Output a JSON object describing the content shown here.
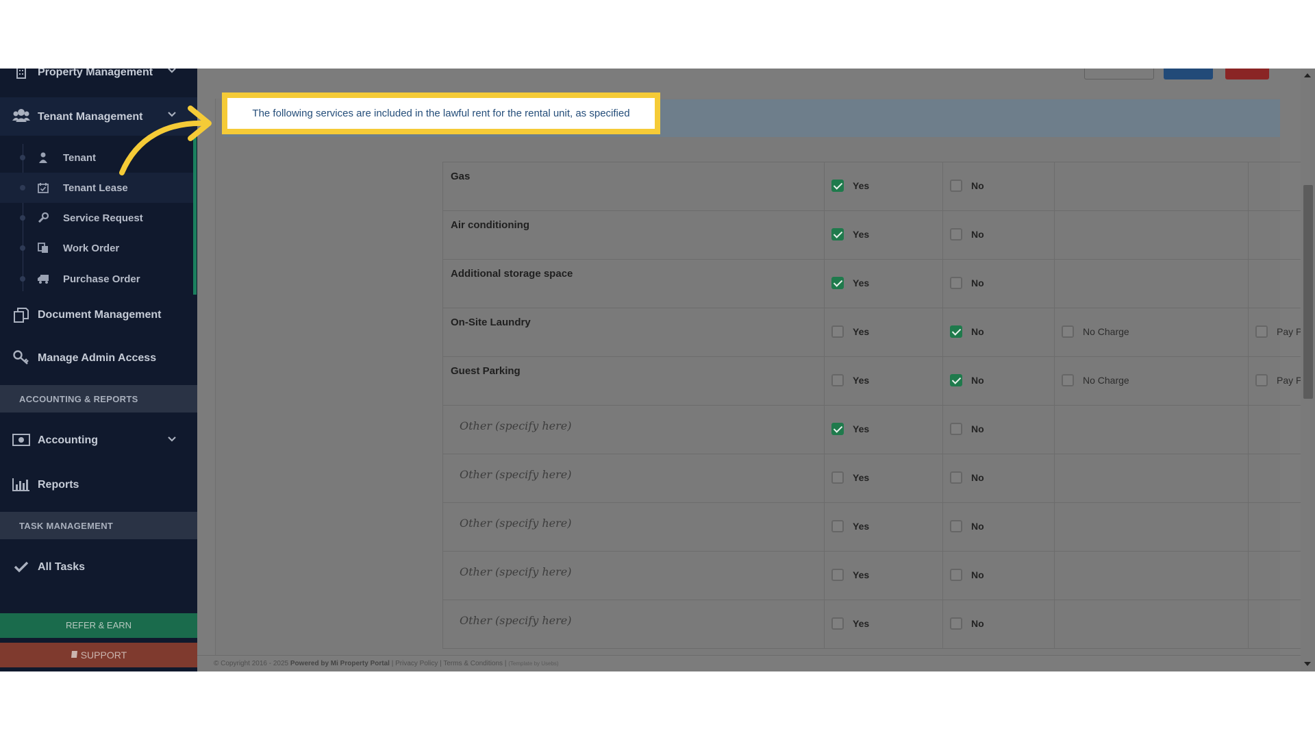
{
  "sidebar": {
    "items": [
      {
        "label": "Property Management",
        "icon": "building-icon",
        "has_chevron": true
      },
      {
        "label": "Tenant Management",
        "icon": "users-icon",
        "has_chevron": true
      },
      {
        "label": "Document Management",
        "icon": "documents-icon"
      },
      {
        "label": "Manage Admin Access",
        "icon": "key-icon"
      },
      {
        "label": "Accounting",
        "icon": "money-icon",
        "has_chevron": true
      },
      {
        "label": "Reports",
        "icon": "bar-chart-icon"
      },
      {
        "label": "All Tasks",
        "icon": "check-icon"
      }
    ],
    "sub_items": [
      {
        "label": "Tenant",
        "icon": "user-icon"
      },
      {
        "label": "Tenant Lease",
        "icon": "calendar-check-icon"
      },
      {
        "label": "Service Request",
        "icon": "wrench-icon"
      },
      {
        "label": "Work Order",
        "icon": "copy-icon"
      },
      {
        "label": "Purchase Order",
        "icon": "truck-icon"
      }
    ],
    "sections": {
      "accounting": "ACCOUNTING & REPORTS",
      "tasks": "TASK MANAGEMENT"
    },
    "refer_label": "REFER & EARN",
    "support_label": "SUPPORT"
  },
  "highlight_text": "The following services are included in the lawful rent for the rental unit, as specified",
  "services": [
    {
      "name": "Gas",
      "yes": true,
      "no": false
    },
    {
      "name": "Air conditioning",
      "yes": true,
      "no": false
    },
    {
      "name": "Additional storage space",
      "yes": true,
      "no": false
    },
    {
      "name": "On-Site Laundry",
      "yes": false,
      "no": true,
      "extra": true
    },
    {
      "name": "Guest Parking",
      "yes": false,
      "no": true,
      "extra": true
    },
    {
      "name": "Other (specify here)",
      "placeholder": true,
      "yes": true,
      "no": false
    },
    {
      "name": "Other (specify here)",
      "placeholder": true,
      "yes": false,
      "no": false
    },
    {
      "name": "Other (specify here)",
      "placeholder": true,
      "yes": false,
      "no": false
    },
    {
      "name": "Other (specify here)",
      "placeholder": true,
      "yes": false,
      "no": false
    },
    {
      "name": "Other (specify here)",
      "placeholder": true,
      "yes": false,
      "no": false
    }
  ],
  "option_labels": {
    "yes": "Yes",
    "no": "No",
    "no_charge": "No Charge",
    "pay_per_use": "Pay Per use"
  },
  "footer": {
    "copyright": "© Copyright 2016 - 2025",
    "powered": "Powered by Mi Property Portal",
    "privacy": "Privacy Policy",
    "terms": "Terms & Conditions",
    "tail": "(Template by Usebs)"
  },
  "colors": {
    "sidebar": "#10192d",
    "check": "#1f7a4c",
    "highlight_border": "#f5cb37",
    "refer": "#1a6b4c",
    "support": "#7f3a2e"
  }
}
